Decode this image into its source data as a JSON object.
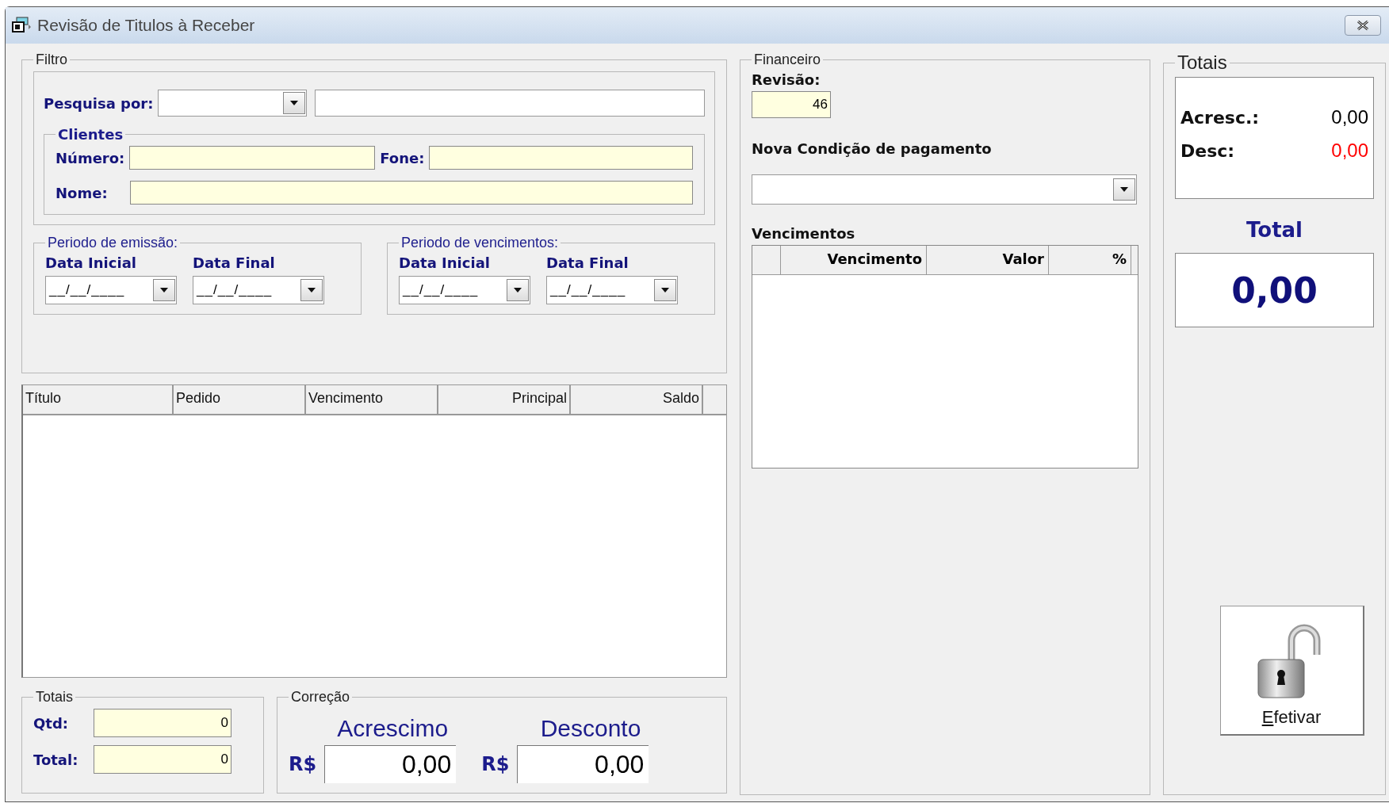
{
  "window": {
    "title": "Revisão de Titulos à Receber"
  },
  "filter": {
    "title": "Filtro",
    "search_label": "Pesquisa por:",
    "clients": {
      "title": "Clientes",
      "number_label": "Número:",
      "phone_label": "Fone:",
      "name_label": "Nome:"
    },
    "periods": [
      {
        "title": "Periodo de emissão:",
        "start_label": "Data Inicial",
        "start_value": "__/__/____",
        "end_label": "Data Final",
        "end_value": "__/__/____"
      },
      {
        "title": "Periodo de vencimentos:",
        "start_label": "Data Inicial",
        "start_value": "__/__/____",
        "end_label": "Data Final",
        "end_value": "__/__/____"
      }
    ]
  },
  "titles_table": {
    "columns": [
      {
        "label": "Título"
      },
      {
        "label": "Pedido"
      },
      {
        "label": "Vencimento"
      },
      {
        "label": "Principal"
      },
      {
        "label": "Saldo"
      }
    ]
  },
  "totals": {
    "title": "Totais",
    "fields": [
      {
        "label": "Qtd:",
        "value": "0"
      },
      {
        "label": "Total:",
        "value": "0"
      }
    ]
  },
  "correction": {
    "title": "Correção",
    "fields": [
      {
        "label": "Acrescimo",
        "currency": "R$",
        "value": "0,00"
      },
      {
        "label": "Desconto",
        "currency": "R$",
        "value": "0,00"
      }
    ]
  },
  "financial": {
    "title": "Financeiro",
    "revision_label": "Revisão:",
    "revision_value": "46",
    "payment_label": "Nova Condição de pagamento",
    "due_label": "Vencimentos",
    "due_columns": [
      {
        "label": "Vencimento"
      },
      {
        "label": "Valor"
      },
      {
        "label": "%"
      }
    ]
  },
  "summary": {
    "title": "Totais",
    "rows": [
      {
        "label": "Acresc.:",
        "value": "0,00",
        "color": "#000000"
      },
      {
        "label": "Desc:",
        "value": "0,00",
        "color": "#ff0000"
      }
    ],
    "total_label": "Total",
    "total_value": "0,00"
  },
  "confirm_button": {
    "label": "Efetivar"
  }
}
